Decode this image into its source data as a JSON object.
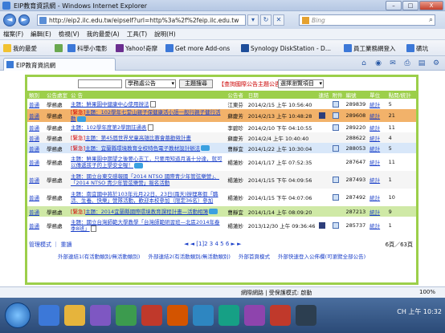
{
  "window": {
    "title": "EIP教育資訊網 - Windows Internet Explorer",
    "min": "–",
    "max": "□",
    "close": "X"
  },
  "address": {
    "url": "http://eip2.ilc.edu.tw/eipself?url=http%3a%2f%2feip.ilc.edu.tw",
    "search_placeholder": "Bing"
  },
  "menu": [
    "檔案(F)",
    "編輯(E)",
    "檢視(V)",
    "我的最愛(A)",
    "工具(T)",
    "說明(H)"
  ],
  "favorites": {
    "label": "我的最愛",
    "items": [
      "科學小電影",
      "Yahoo!奇摩",
      "Get more Add-ons",
      "Synology DiskStation - D...",
      "員工業務網登入",
      "磺坑"
    ]
  },
  "tab": {
    "label": "EIP教育資訊網"
  },
  "portal": {
    "search_input": "",
    "unit_select": "學務處公告",
    "search_button": "主題搜尋",
    "red_link": "【查詢國際公告主題公告】",
    "order_select": "選擇瀏覽項目",
    "columns": [
      "類別",
      "公告處室",
      "公  告",
      "公告者",
      "日期",
      "連結",
      "附件",
      "編號",
      "單位",
      "點閱/統計"
    ],
    "rows": [
      {
        "type": "普通",
        "office": "學務處",
        "flag": "",
        "subject": "主題：鮮果園中健康中心使用辦法",
        "author": "江東芬",
        "date": "2014/2/15 上午 10:56:40",
        "num": "289839",
        "stat": "統計",
        "clicks": "5"
      },
      {
        "type": "普通",
        "office": "學務處",
        "flag": "[緊急]",
        "subject": "主題：102學年七堂山親子保健康活小語一般行親子健行活動",
        "author": "蘇慶芳",
        "date": "2014/2/13 上午 10:48:28",
        "num": "289608",
        "stat": "統計",
        "clicks": "21"
      },
      {
        "type": "普通",
        "office": "學務處",
        "flag": "",
        "subject": "主題：102學年度第2學期註通表",
        "author": "李碧珍",
        "date": "2014/2/10 下午 04:10:55",
        "num": "289220",
        "stat": "統計",
        "clicks": "11"
      },
      {
        "type": "普通",
        "office": "學務處",
        "flag": "[緊急]",
        "subject": "主題：第45屆世界兒童高雄比賽會慕勸徵計畫",
        "author": "蘇慶芳",
        "date": "2014/2/4 上午 10:40:40",
        "num": "288622",
        "stat": "統計",
        "clicks": "4"
      },
      {
        "type": "普通",
        "office": "學務處",
        "flag": "[緊急]",
        "subject": "主題：宜蘭縣環境教育全校特色電子教材設計辦法",
        "author": "曹靜宜",
        "date": "2014/1/22 上午 10:30:04",
        "num": "288053",
        "stat": "統計",
        "clicks": "5"
      },
      {
        "type": "普通",
        "office": "學務處",
        "flag": "",
        "subject": "主題：鮮果園中期望之後要心志工，只要用知道月滿十分達，就可以傳遞孩子的上學安全喔！",
        "author": "楊蓮妙",
        "date": "2014/1/17 上午 07:52:35",
        "num": "287647",
        "stat": "統計",
        "clicks": "11"
      },
      {
        "type": "普通",
        "office": "學務處",
        "flag": "",
        "subject": "主題：國立台東交感報國「2014 NTSO 國際青少年管弦樂營」、「2014 NTSO 青少年管弦樂營」報名活動",
        "author": "楊蓮妙",
        "date": "2014/1/15 下午 04:09:56",
        "num": "287493",
        "stat": "統計",
        "clicks": "1"
      },
      {
        "type": "普通",
        "office": "學務處",
        "flag": "",
        "subject": "主題：南宜國中將於103年元月22日、23日(兩天)辦理寒假「職活、生養、快樂」營隊活動，歡迎本校參加（限定36名）參加",
        "author": "楊蓮妙",
        "date": "2014/1/15 下午 04:07:06",
        "num": "287492",
        "stat": "統計",
        "clicks": "10"
      },
      {
        "type": "普通",
        "office": "學務處",
        "flag": "[緊急]",
        "subject": "主題：2014宜蘭縣國際環境教育課程計畫—活動相簿",
        "author": "曹靜宜",
        "date": "2014/1/14 上午 08:09:20",
        "num": "287213",
        "stat": "統計",
        "clicks": "9"
      },
      {
        "type": "普通",
        "office": "學務處",
        "flag": "",
        "subject": "主題：國立台灣師範大學教學「台灣師範研習班—北區2014年春季8班」",
        "author": "楊蓮妙",
        "date": "2013/12/30 上午 09:36:46",
        "num": "285737",
        "stat": "統計",
        "clicks": "1"
      }
    ],
    "footer_left": "管理模式 ｜ 重讀",
    "pager": "◄ ◄ [1]2 3 4 5 6 ► ►",
    "count": "6頁／63頁",
    "bottom_links": [
      "外部連結1(有活動類別/無活動類別)",
      "外部連結2(有活動類別/無活動類別)",
      "外部首頁模式",
      "外部快速登入公佈欄(可瀏覽全部公告)"
    ]
  },
  "status": {
    "zone": "網際網路 | 受保護模式: 啟動",
    "zoom": "100%"
  },
  "taskbar": {
    "lang": "CH",
    "time": "上午 10:32"
  }
}
